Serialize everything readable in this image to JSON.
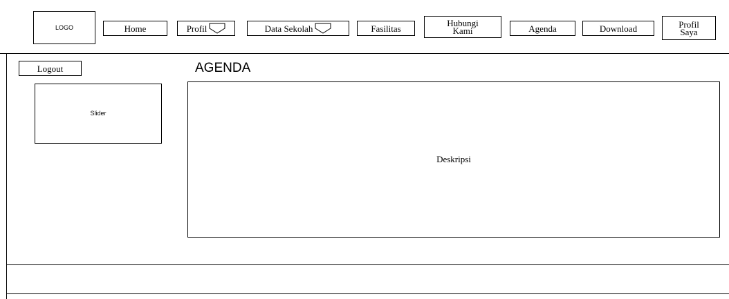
{
  "header": {
    "logo": "LOGO",
    "nav": {
      "home": "Home",
      "profil": "Profil",
      "data_sekolah": "Data Sekolah",
      "fasilitas": "Fasilitas",
      "hubungi_line1": "Hubungi",
      "hubungi_line2": "Kami",
      "agenda": "Agenda",
      "download": "Download",
      "profil_saya_line1": "Profil",
      "profil_saya_line2": "Saya"
    }
  },
  "sidebar": {
    "logout": "Logout",
    "slider": "Slider"
  },
  "main": {
    "title": "AGENDA",
    "description": "Deskripsi"
  }
}
